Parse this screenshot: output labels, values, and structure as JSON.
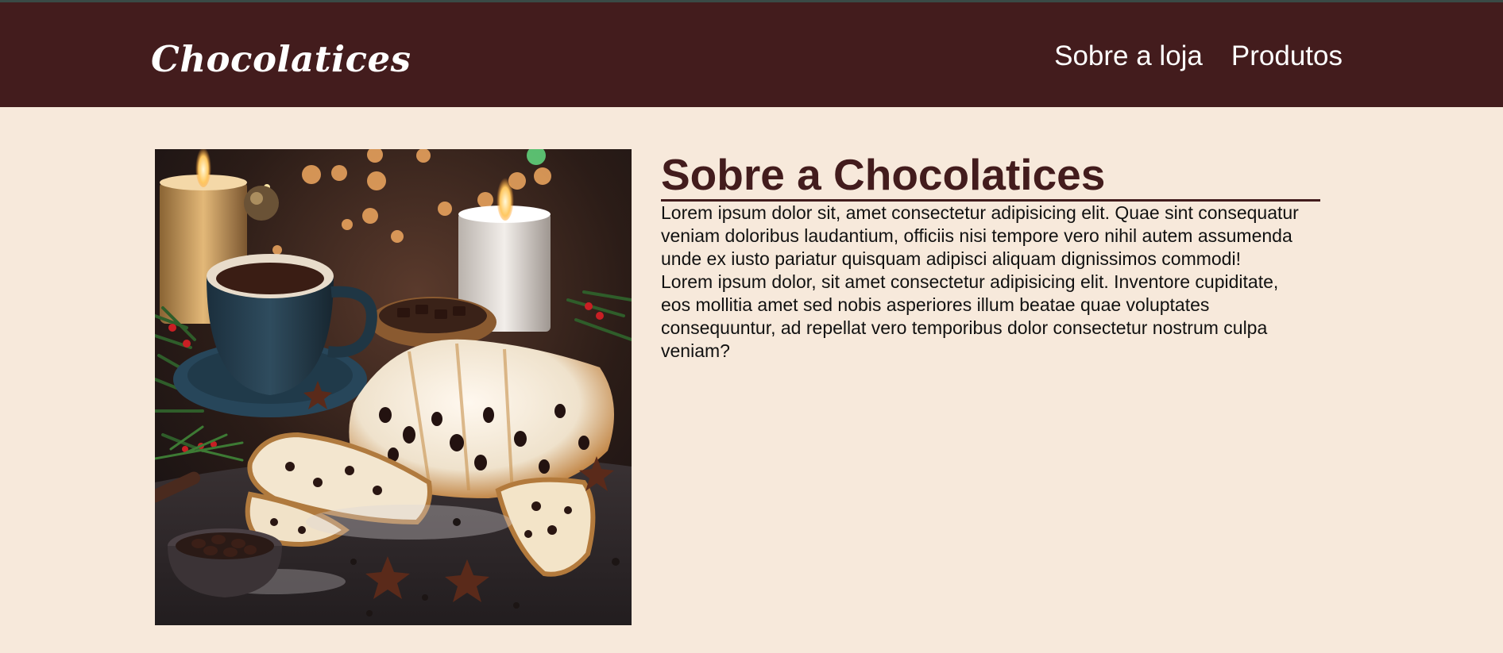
{
  "header": {
    "brand": "Chocolatices",
    "nav": [
      "Sobre a loja",
      "Produtos"
    ]
  },
  "about": {
    "title": "Sobre a Chocolatices",
    "paragraphs": [
      "Lorem ipsum dolor sit, amet consectetur adipisicing elit. Quae sint consequatur veniam doloribus laudantium, officiis nisi tempore vero nihil autem assumenda unde ex iusto pariatur quisquam adipisci aliquam dignissimos commodi!",
      "Lorem ipsum dolor, sit amet consectetur adipisicing elit. Inventore cupiditate, eos mollitia amet sed nobis asperiores illum beatae quae voluptates consequuntur, ad repellat vero temporibus dolor consectetur nostrum culpa veniam?"
    ]
  },
  "colors": {
    "header_bg": "#431c1d",
    "page_bg": "#f7e9db",
    "title": "#431c1d"
  }
}
